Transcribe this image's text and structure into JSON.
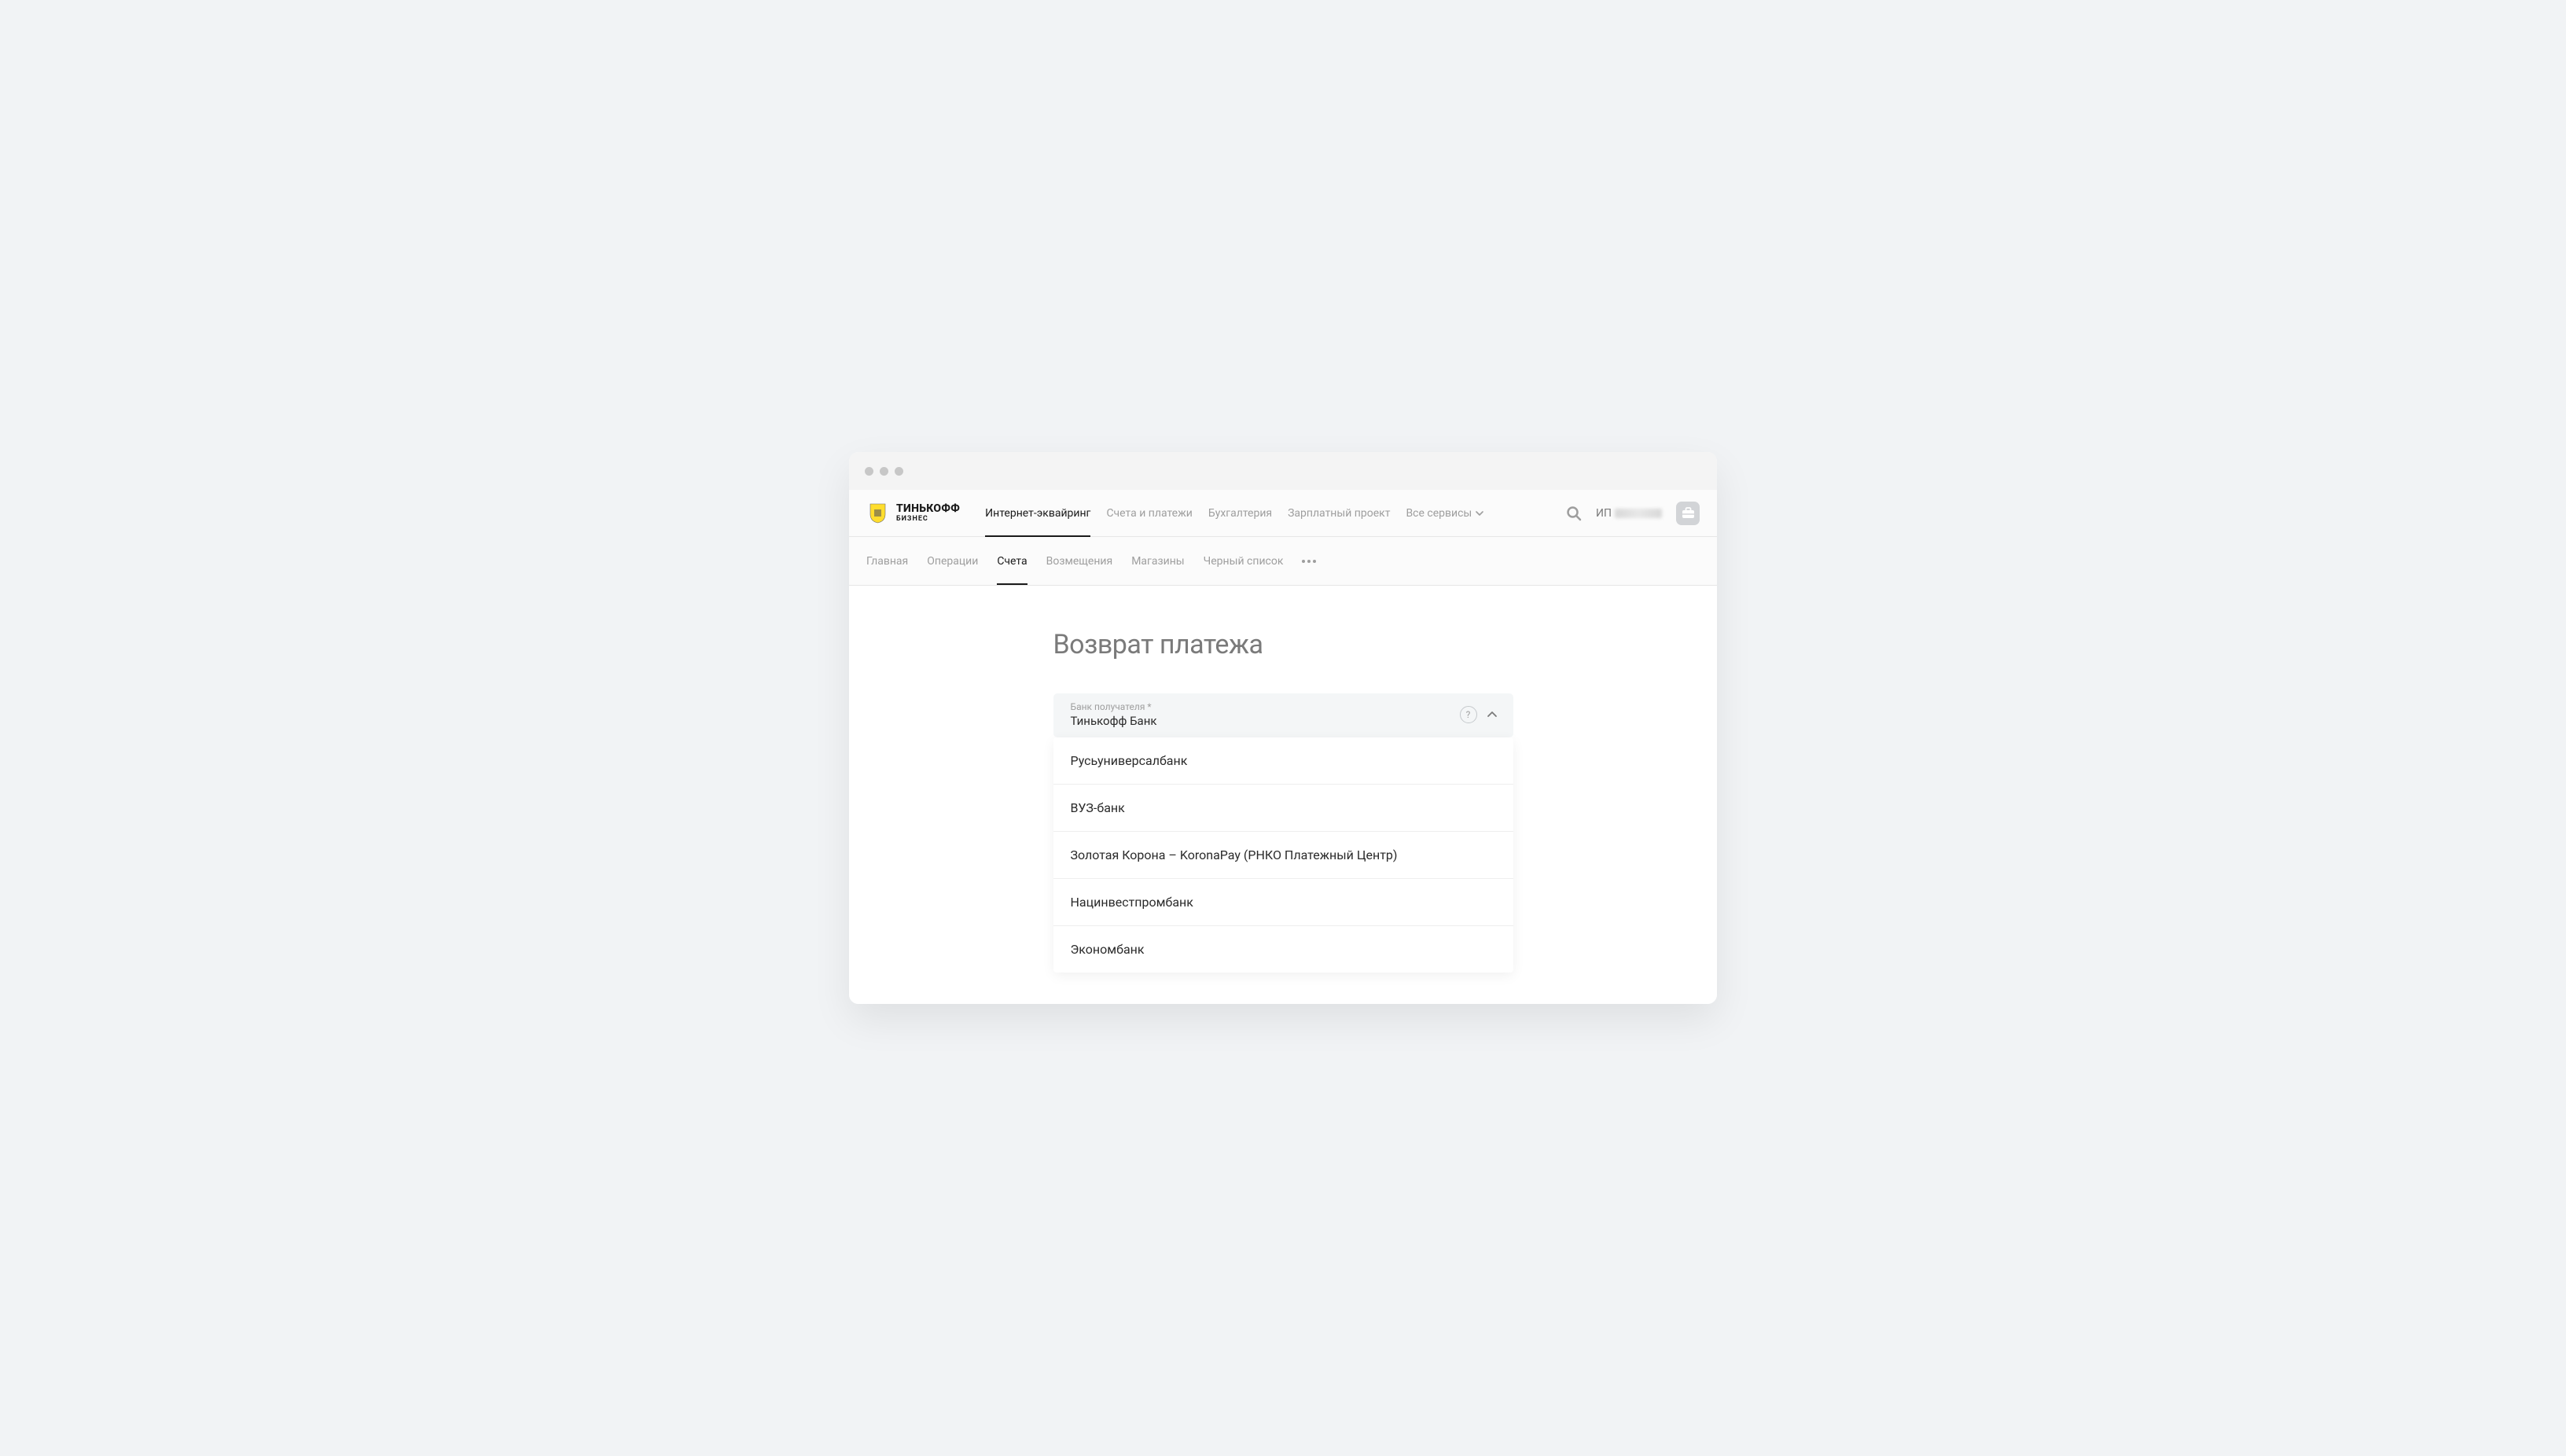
{
  "logo": {
    "brand": "ТИНЬКОФФ",
    "sub": "БИЗНЕС"
  },
  "main_nav": [
    {
      "label": "Интернет-эквайринг",
      "active": true
    },
    {
      "label": "Счета и платежи",
      "active": false
    },
    {
      "label": "Бухгалтерия",
      "active": false
    },
    {
      "label": "Зарплатный проект",
      "active": false
    }
  ],
  "all_services": "Все сервисы",
  "user_prefix": "ИП",
  "sub_nav": [
    {
      "label": "Главная",
      "active": false
    },
    {
      "label": "Операции",
      "active": false
    },
    {
      "label": "Счета",
      "active": true
    },
    {
      "label": "Возмещения",
      "active": false
    },
    {
      "label": "Магазины",
      "active": false
    },
    {
      "label": "Черный список",
      "active": false
    }
  ],
  "page_title": "Возврат платежа",
  "bank_select": {
    "label": "Банк получателя *",
    "value": "Тинькофф Банк",
    "options": [
      "Русьуниверсалбанк",
      "ВУЗ-банк",
      "Золотая Корона – KoronaPay (РНКО Платежный Центр)",
      "Нацинвестпромбанк",
      "Экономбанк"
    ]
  }
}
